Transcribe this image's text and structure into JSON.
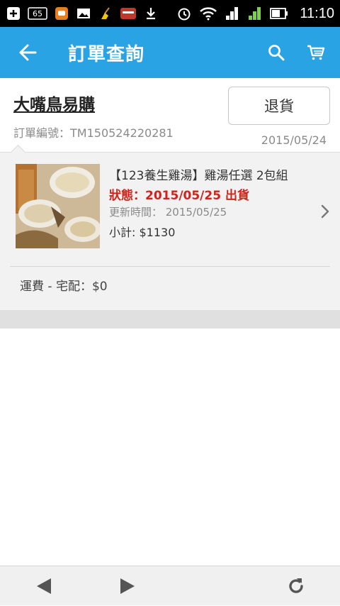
{
  "status_bar": {
    "time": "11:10",
    "icons": [
      "add-icon",
      "badge-65-icon",
      "chat-icon",
      "image-icon",
      "broom-icon",
      "app-store-icon",
      "download-icon",
      "alarm-icon",
      "wifi-icon",
      "signal-1-icon",
      "signal-2-icon",
      "battery-icon"
    ],
    "badge_text": "65",
    "sim1": "1",
    "sim2": "2"
  },
  "app_bar": {
    "title": "訂單查詢",
    "color": "#29a3e3",
    "icons": [
      "back-arrow-icon",
      "search-icon",
      "cart-icon"
    ]
  },
  "order": {
    "store_name": "大嘴鳥易購",
    "return_label": "退貨",
    "order_number": "訂單編號：TM150524220281",
    "date": "2015/05/24"
  },
  "item": {
    "title": "【123養生雞湯】雞湯任選 2包組",
    "status": "狀態：2015/05/25 出貨",
    "status_color": "#d0231c",
    "update_time": "更新時間： 2015/05/25",
    "subtotal": "小計: $1130",
    "chevron_icon": "chevron-right-icon"
  },
  "shipping": {
    "text": "運費 - 宅配：$0"
  },
  "bottom_bar": {
    "icons": [
      "back-triangle-icon",
      "forward-triangle-icon",
      "refresh-icon"
    ]
  }
}
